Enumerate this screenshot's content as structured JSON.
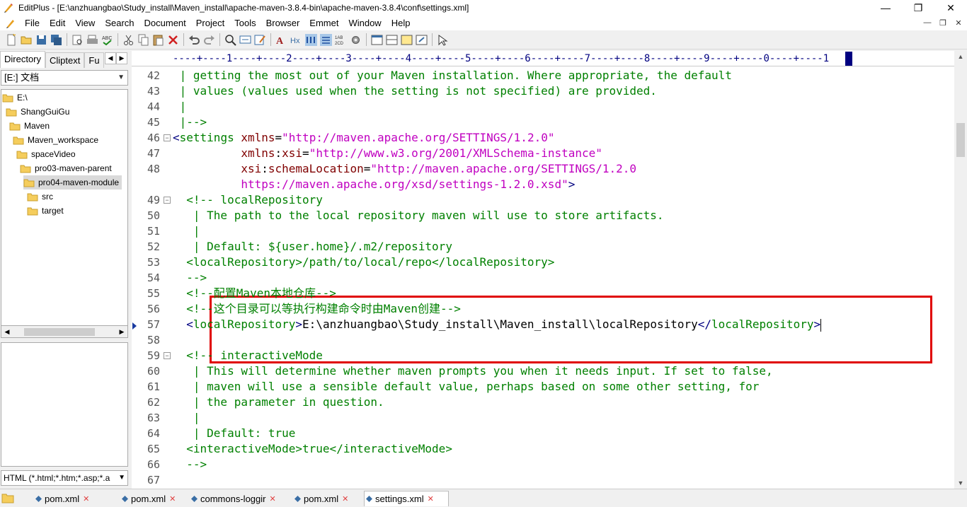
{
  "window": {
    "title": "EditPlus - [E:\\anzhuangbao\\Study_install\\Maven_install\\apache-maven-3.8.4-bin\\apache-maven-3.8.4\\conf\\settings.xml]",
    "controls": {
      "minimize": "—",
      "maximize": "❐",
      "close": "✕"
    }
  },
  "menu": {
    "items": [
      "File",
      "Edit",
      "View",
      "Search",
      "Document",
      "Project",
      "Tools",
      "Browser",
      "Emmet",
      "Window",
      "Help"
    ],
    "mdi": {
      "minimize": "—",
      "restore": "❐",
      "close": "✕"
    }
  },
  "toolbar": {
    "buttons": [
      "new-file-icon",
      "open-folder-icon",
      "save-icon",
      "save-all-icon",
      "print-preview-icon",
      "print-icon",
      "spellcheck-icon",
      "cut-icon",
      "copy-icon",
      "paste-icon",
      "delete-icon",
      "undo-icon",
      "redo-icon",
      "find-icon",
      "replace-icon",
      "edit-icon",
      "font-icon",
      "hex-icon",
      "word-wrap-icon",
      "line-numbers-icon",
      "column-icon",
      "settings-icon",
      "browser-icon",
      "split-icon",
      "screen-icon",
      "fullscreen-icon",
      "help-icon"
    ]
  },
  "left_panel": {
    "tabs": [
      "Directory",
      "Cliptext",
      "Fu"
    ],
    "tab_nav": {
      "prev": "◀",
      "next": "▶"
    },
    "drive": "[E:] 文档",
    "drive_arrow": "▼",
    "tree": [
      {
        "label": "E:\\",
        "level": 0,
        "selected": false
      },
      {
        "label": "ShangGuiGu",
        "level": 1,
        "selected": false
      },
      {
        "label": "Maven",
        "level": 2,
        "selected": false
      },
      {
        "label": "Maven_workspace",
        "level": 3,
        "selected": false
      },
      {
        "label": "spaceVideo",
        "level": 4,
        "selected": false
      },
      {
        "label": "pro03-maven-parent",
        "level": 5,
        "selected": false
      },
      {
        "label": "pro04-maven-module",
        "level": 6,
        "selected": true
      },
      {
        "label": "src",
        "level": 7,
        "selected": false
      },
      {
        "label": "target",
        "level": 7,
        "selected": false
      }
    ],
    "tree_scroll": {
      "left": "◀",
      "right": "▶"
    },
    "filter": "HTML (*.html;*.htm;*.asp;*.a",
    "filter_arrow": "▼"
  },
  "editor": {
    "ruler": "----+----1----+----2----+----3----+----4----+----5----+----6----+----7----+----8----+----9----+----0----+----1",
    "lines": [
      {
        "num": "42",
        "fold": false,
        "bookmark": false,
        "tokens": [
          {
            "c": "cmt",
            "t": " | getting the most out of your Maven installation. Where appropriate, the default"
          }
        ]
      },
      {
        "num": "43",
        "fold": false,
        "bookmark": false,
        "tokens": [
          {
            "c": "cmt",
            "t": " | values (values used when the setting is not specified) are provided."
          }
        ]
      },
      {
        "num": "44",
        "fold": false,
        "bookmark": false,
        "tokens": [
          {
            "c": "cmt",
            "t": " |"
          }
        ]
      },
      {
        "num": "45",
        "fold": false,
        "bookmark": false,
        "tokens": [
          {
            "c": "cmt",
            "t": " |-->"
          }
        ]
      },
      {
        "num": "46",
        "fold": true,
        "bookmark": false,
        "tokens": [
          {
            "c": "br",
            "t": "<"
          },
          {
            "c": "cmt",
            "t": "settings"
          },
          {
            "c": "txt",
            "t": " "
          },
          {
            "c": "attr",
            "t": "xmlns"
          },
          {
            "c": "txt",
            "t": "="
          },
          {
            "c": "str",
            "t": "\"http://maven.apache.org/SETTINGS/1.2.0\""
          }
        ]
      },
      {
        "num": "47",
        "fold": false,
        "bookmark": false,
        "tokens": [
          {
            "c": "txt",
            "t": "          "
          },
          {
            "c": "attr",
            "t": "xmlns"
          },
          {
            "c": "txt",
            "t": ":"
          },
          {
            "c": "attr",
            "t": "xsi"
          },
          {
            "c": "txt",
            "t": "="
          },
          {
            "c": "str",
            "t": "\"http://www.w3.org/2001/XMLSchema-instance\""
          }
        ]
      },
      {
        "num": "48",
        "fold": false,
        "bookmark": false,
        "tokens": [
          {
            "c": "txt",
            "t": "          "
          },
          {
            "c": "attr",
            "t": "xsi"
          },
          {
            "c": "txt",
            "t": ":"
          },
          {
            "c": "attr",
            "t": "schemaLocation"
          },
          {
            "c": "txt",
            "t": "="
          },
          {
            "c": "str",
            "t": "\"http://maven.apache.org/SETTINGS/1.2.0"
          }
        ]
      },
      {
        "num": "",
        "fold": false,
        "bookmark": false,
        "tokens": [
          {
            "c": "str",
            "t": "          https://maven.apache.org/xsd/settings-1.2.0.xsd\""
          },
          {
            "c": "br",
            "t": ">"
          }
        ]
      },
      {
        "num": "49",
        "fold": true,
        "bookmark": false,
        "tokens": [
          {
            "c": "cmt",
            "t": "  <!-- localRepository"
          }
        ]
      },
      {
        "num": "50",
        "fold": false,
        "bookmark": false,
        "tokens": [
          {
            "c": "cmt",
            "t": "   | The path to the local repository maven will use to store artifacts."
          }
        ]
      },
      {
        "num": "51",
        "fold": false,
        "bookmark": false,
        "tokens": [
          {
            "c": "cmt",
            "t": "   |"
          }
        ]
      },
      {
        "num": "52",
        "fold": false,
        "bookmark": false,
        "tokens": [
          {
            "c": "cmt",
            "t": "   | Default: ${user.home}/.m2/repository"
          }
        ]
      },
      {
        "num": "53",
        "fold": false,
        "bookmark": false,
        "tokens": [
          {
            "c": "cmt",
            "t": "  <localRepository>/path/to/local/repo</localRepository>"
          }
        ]
      },
      {
        "num": "54",
        "fold": false,
        "bookmark": false,
        "tokens": [
          {
            "c": "cmt",
            "t": "  -->"
          }
        ]
      },
      {
        "num": "55",
        "fold": false,
        "bookmark": false,
        "tokens": [
          {
            "c": "cmt",
            "t": "  <!--配置Maven本地仓库-->"
          }
        ]
      },
      {
        "num": "56",
        "fold": false,
        "bookmark": false,
        "tokens": [
          {
            "c": "cmt",
            "t": "  <!--这个目录可以等执行构建命令时由Maven创建-->"
          }
        ]
      },
      {
        "num": "57",
        "fold": false,
        "bookmark": true,
        "caret": true,
        "tokens": [
          {
            "c": "txt",
            "t": "  "
          },
          {
            "c": "br",
            "t": "<"
          },
          {
            "c": "cmt",
            "t": "localRepository"
          },
          {
            "c": "br",
            "t": ">"
          },
          {
            "c": "txt",
            "t": "E:\\anzhuangbao\\Study_install\\Maven_install\\localRepository"
          },
          {
            "c": "br",
            "t": "</"
          },
          {
            "c": "cmt",
            "t": "localRepository"
          },
          {
            "c": "br",
            "t": ">"
          }
        ]
      },
      {
        "num": "58",
        "fold": false,
        "bookmark": false,
        "tokens": [
          {
            "c": "txt",
            "t": ""
          }
        ]
      },
      {
        "num": "59",
        "fold": true,
        "bookmark": false,
        "tokens": [
          {
            "c": "cmt",
            "t": "  <!-- interactiveMode"
          }
        ]
      },
      {
        "num": "60",
        "fold": false,
        "bookmark": false,
        "tokens": [
          {
            "c": "cmt",
            "t": "   | This will determine whether maven prompts you when it needs input. If set to false,"
          }
        ]
      },
      {
        "num": "61",
        "fold": false,
        "bookmark": false,
        "tokens": [
          {
            "c": "cmt",
            "t": "   | maven will use a sensible default value, perhaps based on some other setting, for"
          }
        ]
      },
      {
        "num": "62",
        "fold": false,
        "bookmark": false,
        "tokens": [
          {
            "c": "cmt",
            "t": "   | the parameter in question."
          }
        ]
      },
      {
        "num": "63",
        "fold": false,
        "bookmark": false,
        "tokens": [
          {
            "c": "cmt",
            "t": "   |"
          }
        ]
      },
      {
        "num": "64",
        "fold": false,
        "bookmark": false,
        "tokens": [
          {
            "c": "cmt",
            "t": "   | Default: true"
          }
        ]
      },
      {
        "num": "65",
        "fold": false,
        "bookmark": false,
        "tokens": [
          {
            "c": "cmt",
            "t": "  <interactiveMode>true</interactiveMode>"
          }
        ]
      },
      {
        "num": "66",
        "fold": false,
        "bookmark": false,
        "tokens": [
          {
            "c": "cmt",
            "t": "  -->"
          }
        ]
      },
      {
        "num": "67",
        "fold": false,
        "bookmark": false,
        "tokens": [
          {
            "c": "txt",
            "t": ""
          }
        ]
      }
    ]
  },
  "scrollbar": {
    "up": "▲",
    "down": "▼"
  },
  "file_tabs": [
    {
      "label": "pom.xml",
      "active": false
    },
    {
      "label": "pom.xml",
      "active": false
    },
    {
      "label": "commons-loggir",
      "active": false
    },
    {
      "label": "pom.xml",
      "active": false
    },
    {
      "label": "settings.xml",
      "active": true
    }
  ],
  "file_tab_close": "✕",
  "colors": {
    "comment": "#008000",
    "tag": "#000080",
    "attr": "#800000",
    "string": "#c000c0",
    "highlight_box": "#e00000"
  }
}
